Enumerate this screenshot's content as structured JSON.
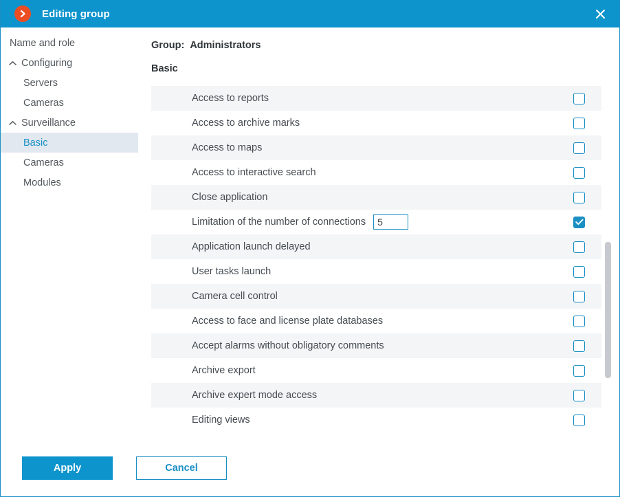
{
  "titlebar": {
    "title": "Editing group",
    "app_icon": "chevron-right-circle-icon",
    "close_icon": "close-icon",
    "accent_color": "#0d94cd",
    "badge_color": "#ed4d23"
  },
  "sidebar": {
    "items": [
      {
        "label": "Name and role",
        "level": "root",
        "caret": "",
        "selected": false
      },
      {
        "label": "Configuring",
        "level": "group",
        "caret": "chevron-up-icon",
        "selected": false
      },
      {
        "label": "Servers",
        "level": "child",
        "caret": "",
        "selected": false
      },
      {
        "label": "Cameras",
        "level": "child",
        "caret": "",
        "selected": false
      },
      {
        "label": "Surveillance",
        "level": "group",
        "caret": "chevron-up-icon",
        "selected": false
      },
      {
        "label": "Basic",
        "level": "child",
        "caret": "",
        "selected": true
      },
      {
        "label": "Cameras",
        "level": "child",
        "caret": "",
        "selected": false
      },
      {
        "label": "Modules",
        "level": "child",
        "caret": "",
        "selected": false
      }
    ],
    "selected_bg": "#e2e8ef",
    "selected_fg": "#1a8fc4"
  },
  "content": {
    "group_label": "Group:",
    "group_value": "Administrators",
    "section_title": "Basic",
    "permissions": [
      {
        "label": "Access to reports",
        "checked": false,
        "has_input": false
      },
      {
        "label": "Access to archive marks",
        "checked": false,
        "has_input": false
      },
      {
        "label": "Access to maps",
        "checked": false,
        "has_input": false
      },
      {
        "label": "Access to interactive search",
        "checked": false,
        "has_input": false
      },
      {
        "label": "Close application",
        "checked": false,
        "has_input": false
      },
      {
        "label": "Limitation of the number of connections",
        "checked": true,
        "has_input": true,
        "input_value": "5"
      },
      {
        "label": "Application launch delayed",
        "checked": false,
        "has_input": false
      },
      {
        "label": "User tasks launch",
        "checked": false,
        "has_input": false
      },
      {
        "label": "Camera cell control",
        "checked": false,
        "has_input": false
      },
      {
        "label": "Access to face and license plate databases",
        "checked": false,
        "has_input": false
      },
      {
        "label": "Accept alarms without obligatory comments",
        "checked": false,
        "has_input": false
      },
      {
        "label": "Archive export",
        "checked": false,
        "has_input": false
      },
      {
        "label": "Archive expert mode access",
        "checked": false,
        "has_input": false
      },
      {
        "label": "Editing views",
        "checked": false,
        "has_input": false
      }
    ],
    "row_alt_bg": "#f4f5f7",
    "checkbox_color": "#1a8fc4"
  },
  "scrollbar": {
    "thumb_color": "#c7c9cf",
    "orientation": "vertical"
  },
  "footer": {
    "apply_label": "Apply",
    "cancel_label": "Cancel"
  }
}
